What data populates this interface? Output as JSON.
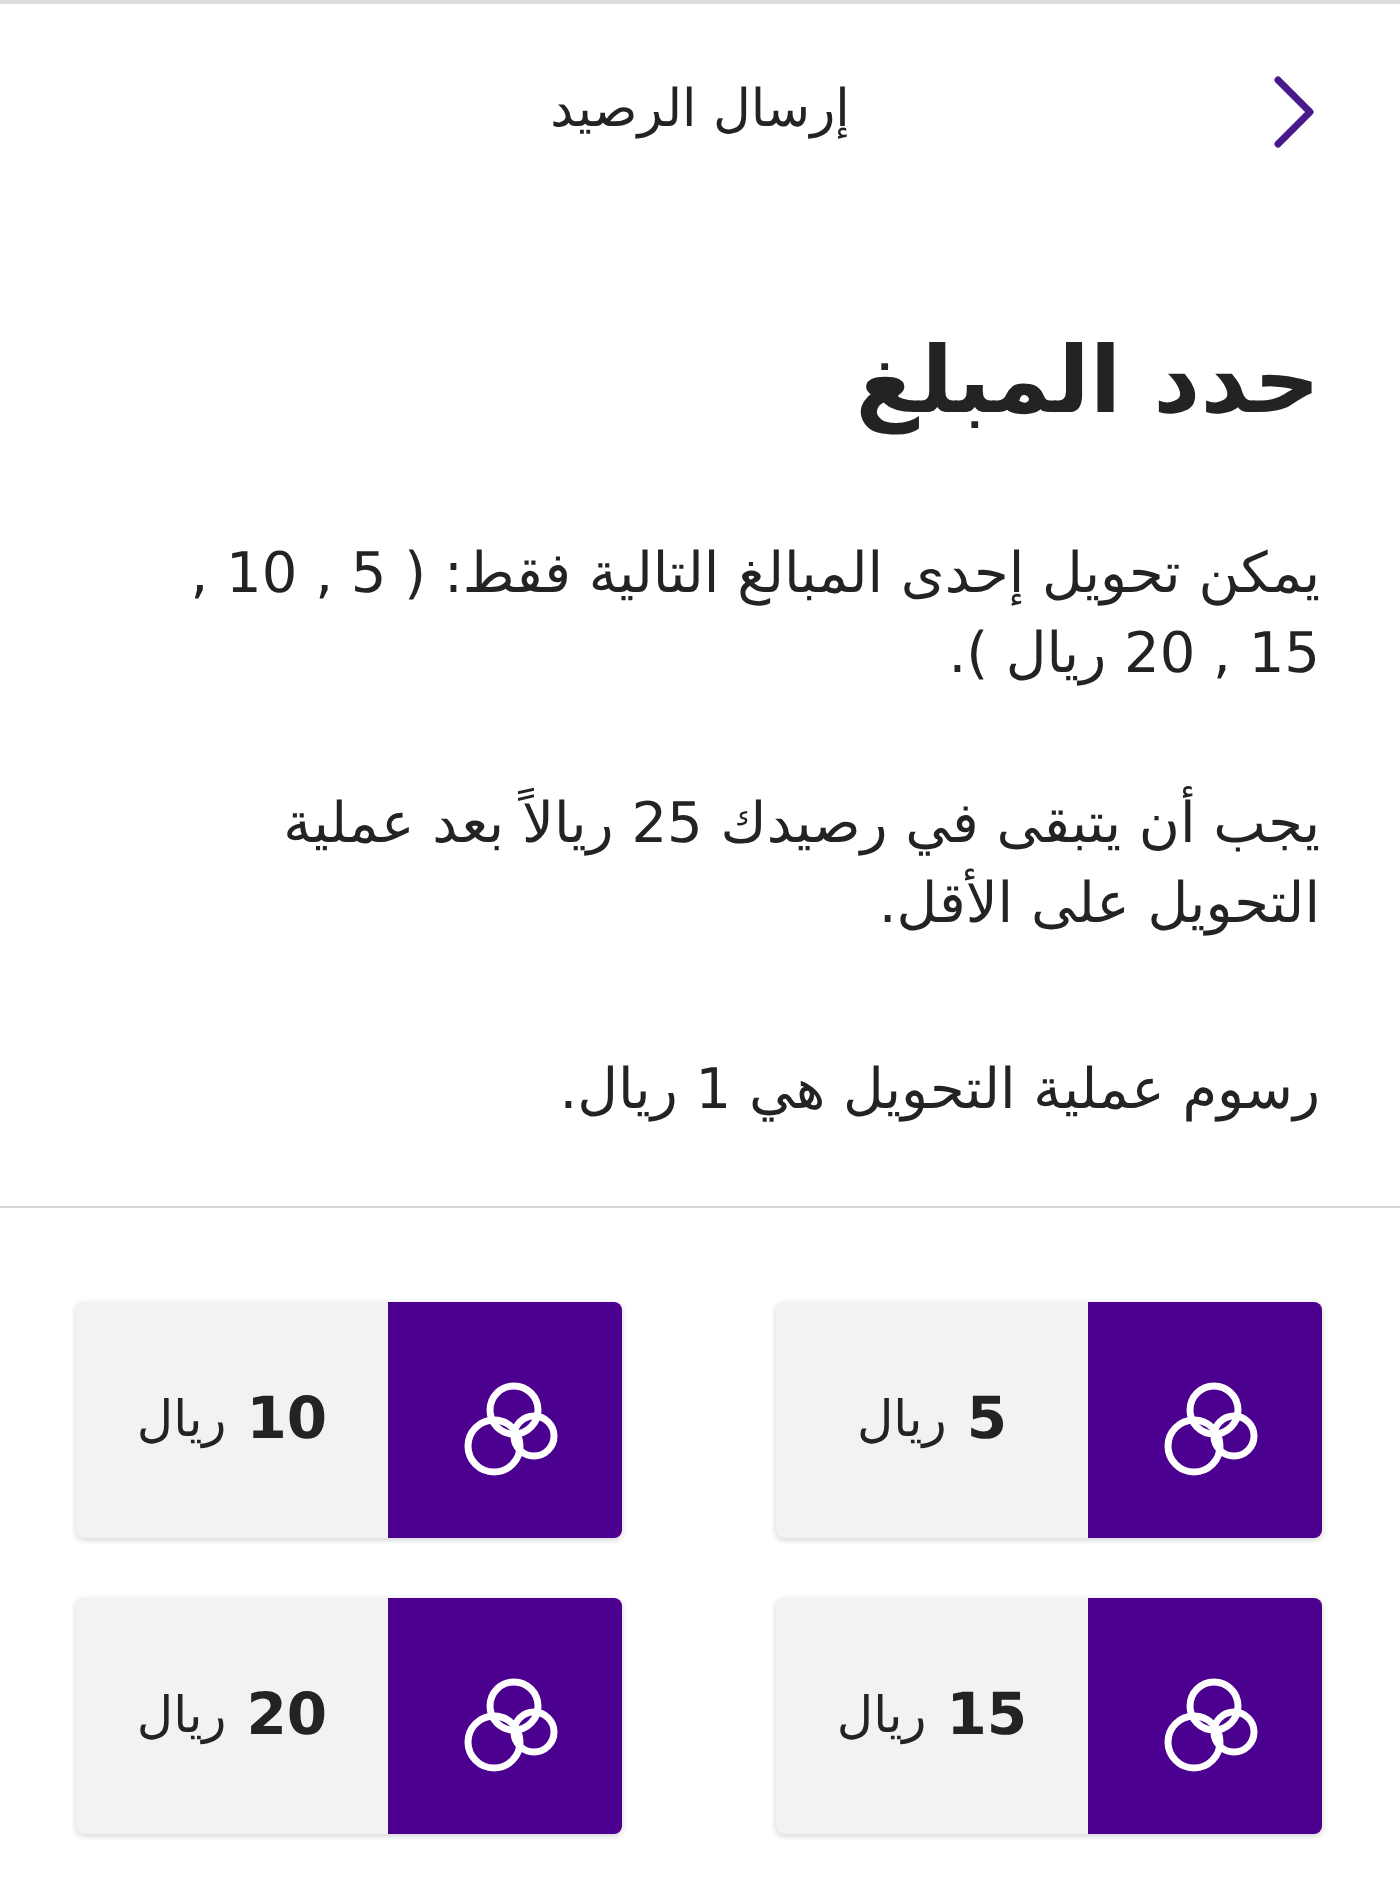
{
  "header": {
    "title": "إرسال الرصيد"
  },
  "heading": "حدد المبلغ",
  "notes": [
    "يمكن تحويل إحدى المبالغ التالية فقط: ( 5 , 10 , 15 , 20 ريال ).",
    "يجب أن يتبقى في رصيدك 25 ريالاً بعد عملية التحويل على الأقل.",
    "رسوم عملية التحويل هي 1 ريال."
  ],
  "amounts": [
    {
      "amount": "5",
      "currency": "ريال",
      "selected": false
    },
    {
      "amount": "10",
      "currency": "ريال",
      "selected": false
    },
    {
      "amount": "15",
      "currency": "ريال",
      "selected": false
    },
    {
      "amount": "20",
      "currency": "ريال",
      "selected": false
    }
  ]
}
